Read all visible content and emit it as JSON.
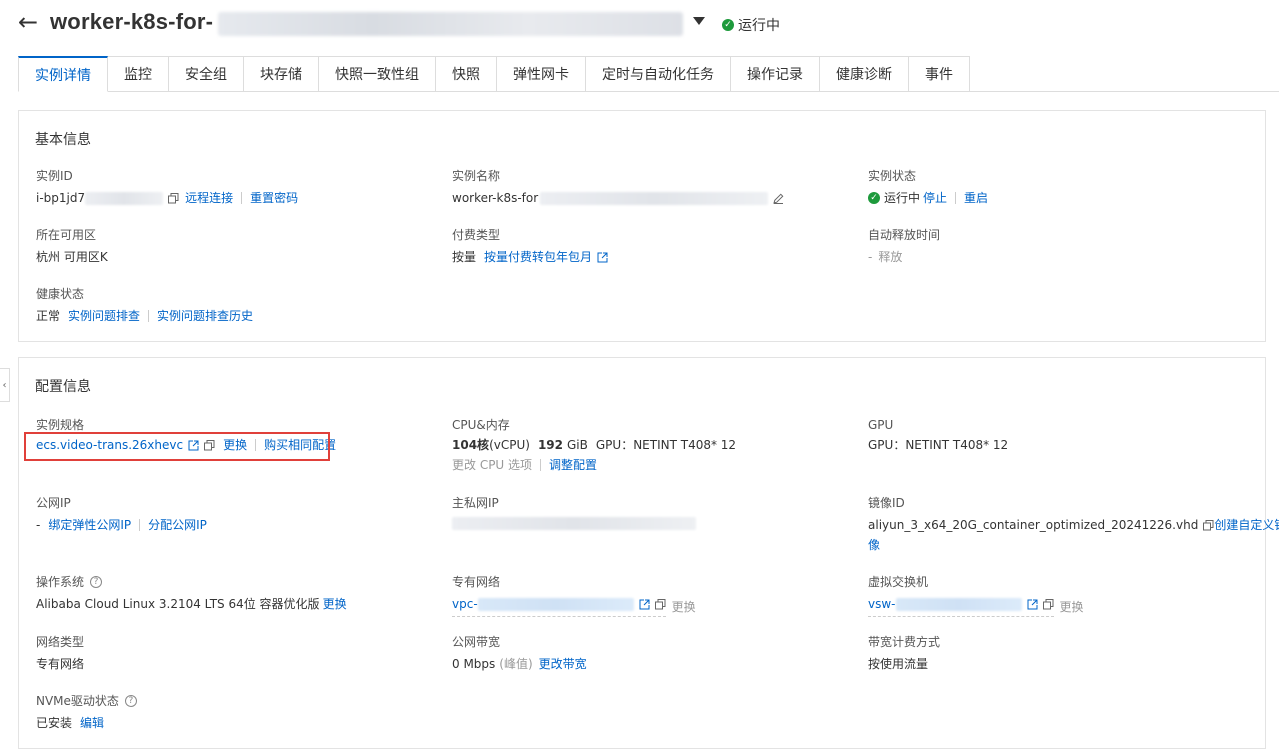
{
  "header": {
    "back_label": "←",
    "title": "worker-k8s-for-",
    "status": "运行中"
  },
  "tabs": [
    {
      "label": "实例详情"
    },
    {
      "label": "监控"
    },
    {
      "label": "安全组"
    },
    {
      "label": "块存储"
    },
    {
      "label": "快照一致性组"
    },
    {
      "label": "快照"
    },
    {
      "label": "弹性网卡"
    },
    {
      "label": "定时与自动化任务"
    },
    {
      "label": "操作记录"
    },
    {
      "label": "健康诊断"
    },
    {
      "label": "事件"
    }
  ],
  "basic": {
    "title": "基本信息",
    "instance_id": {
      "label": "实例ID",
      "value_prefix": "i-bp1jd7",
      "remote": "远程连接",
      "reset_pwd": "重置密码"
    },
    "instance_name": {
      "label": "实例名称",
      "value_prefix": "worker-k8s-for"
    },
    "instance_status": {
      "label": "实例状态",
      "value": "运行中",
      "stop": "停止",
      "restart": "重启"
    },
    "zone": {
      "label": "所在可用区",
      "value": "杭州 可用区K"
    },
    "billing": {
      "label": "付费类型",
      "value": "按量",
      "convert": "按量付费转包年包月"
    },
    "auto_release": {
      "label": "自动释放时间",
      "value": "-",
      "release": "释放"
    },
    "health": {
      "label": "健康状态",
      "value": "正常",
      "troubleshoot": "实例问题排查",
      "history": "实例问题排查历史"
    }
  },
  "config": {
    "title": "配置信息",
    "spec": {
      "label": "实例规格",
      "value": "ecs.video-trans.26xhevc",
      "change": "更换",
      "buy_same": "购买相同配置"
    },
    "cpu_mem": {
      "label": "CPU&内存",
      "cpu": "104核",
      "cpu_unit": "(vCPU)",
      "mem": "192",
      "mem_unit": "GiB",
      "gpu": "GPU：NETINT T408* 12",
      "change_cpu": "更改 CPU 选项",
      "adjust": "调整配置"
    },
    "gpu": {
      "label": "GPU",
      "value": "GPU：NETINT T408* 12"
    },
    "public_ip": {
      "label": "公网IP",
      "value": "-",
      "bind_eip": "绑定弹性公网IP",
      "assign": "分配公网IP"
    },
    "private_ip": {
      "label": "主私网IP"
    },
    "image_id": {
      "label": "镜像ID",
      "value": "aliyun_3_x64_20G_container_optimized_20241226.vhd",
      "create_custom": "创建自定义镜",
      "create_custom_2": "像"
    },
    "os": {
      "label": "操作系统",
      "value": "Alibaba Cloud Linux 3.2104 LTS 64位 容器优化版",
      "change": "更换"
    },
    "vpc": {
      "label": "专有网络",
      "value_prefix": "vpc-",
      "change": "更换"
    },
    "vswitch": {
      "label": "虚拟交换机",
      "value_prefix": "vsw-",
      "change": "更换"
    },
    "net_type": {
      "label": "网络类型",
      "value": "专有网络"
    },
    "bandwidth": {
      "label": "公网带宽",
      "value": "0 Mbps",
      "peak": "(峰值)",
      "change": "更改带宽"
    },
    "bw_billing": {
      "label": "带宽计费方式",
      "value": "按使用流量"
    },
    "nvme": {
      "label": "NVMe驱动状态",
      "value": "已安装",
      "edit": "编辑"
    }
  },
  "icons": {
    "copy": "copy-icon",
    "edit": "edit-icon",
    "external": "external-link-icon",
    "help": "help-icon",
    "ok": "check-circle-icon"
  },
  "colors": {
    "link": "#0064c8",
    "success": "#1e9a3c",
    "highlight_box": "#e0403a"
  }
}
